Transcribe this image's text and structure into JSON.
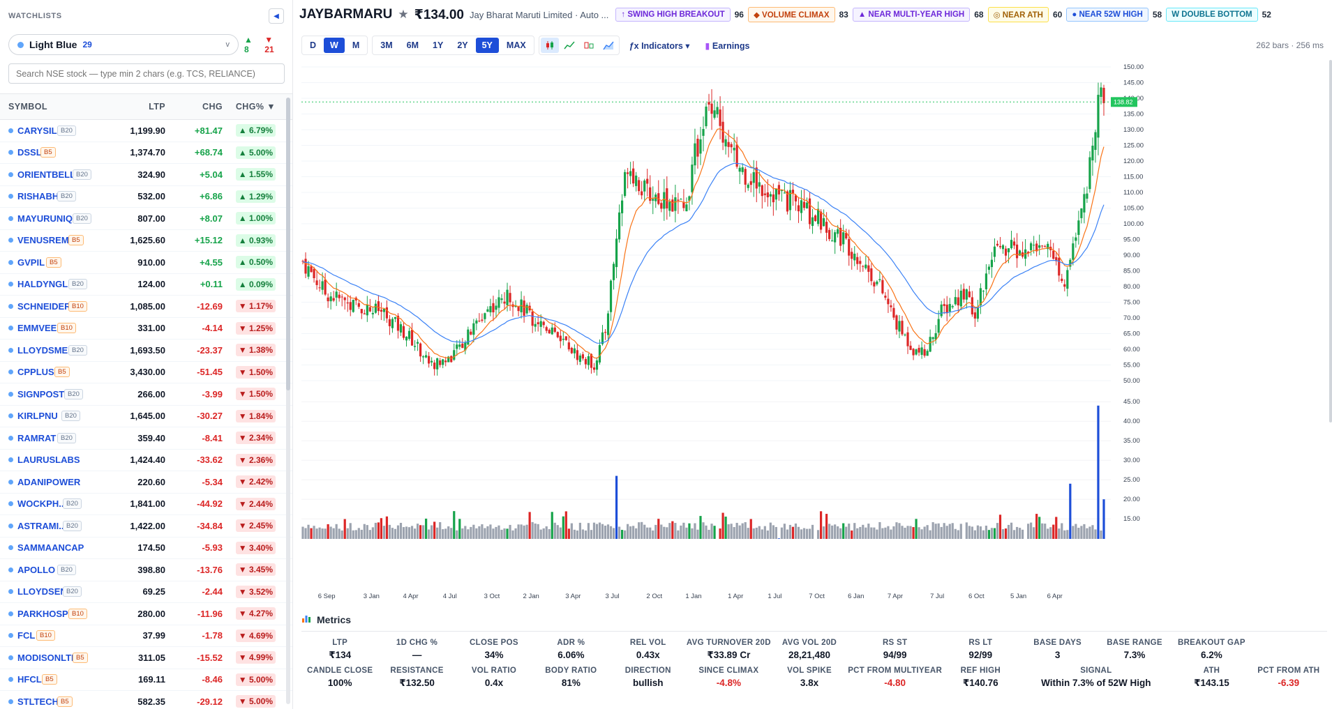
{
  "sidebar": {
    "title": "WATCHLISTS",
    "collapse_icon": "◀",
    "watchlist": {
      "name": "Light Blue",
      "count": "29",
      "advances": "▲ 8",
      "declines": "▼ 21"
    },
    "search_placeholder": "Search NSE stock — type min 2 chars (e.g. TCS, RELIANCE)",
    "columns": {
      "symbol": "SYMBOL",
      "ltp": "LTP",
      "chg": "CHG",
      "pct": "CHG% ▼"
    },
    "rows": [
      {
        "sym": "CARYSIL",
        "badge": "B20",
        "ltp": "1,199.90",
        "chg": "+81.47",
        "pct": "▲ 6.79%",
        "dir": "up"
      },
      {
        "sym": "DSSL",
        "badge": "B5",
        "ltp": "1,374.70",
        "chg": "+68.74",
        "pct": "▲ 5.00%",
        "dir": "up"
      },
      {
        "sym": "ORIENTBELL",
        "badge": "B20",
        "ltp": "324.90",
        "chg": "+5.04",
        "pct": "▲ 1.55%",
        "dir": "up"
      },
      {
        "sym": "RISHABH",
        "badge": "B20",
        "ltp": "532.00",
        "chg": "+6.86",
        "pct": "▲ 1.29%",
        "dir": "up"
      },
      {
        "sym": "MAYURUNIQ",
        "badge": "B20",
        "ltp": "807.00",
        "chg": "+8.07",
        "pct": "▲ 1.00%",
        "dir": "up"
      },
      {
        "sym": "VENUSREM",
        "badge": "B5",
        "ltp": "1,625.60",
        "chg": "+15.12",
        "pct": "▲ 0.93%",
        "dir": "up"
      },
      {
        "sym": "GVPIL",
        "badge": "B5",
        "ltp": "910.00",
        "chg": "+4.55",
        "pct": "▲ 0.50%",
        "dir": "up"
      },
      {
        "sym": "HALDYNGL",
        "badge": "B20",
        "ltp": "124.00",
        "chg": "+0.11",
        "pct": "▲ 0.09%",
        "dir": "up"
      },
      {
        "sym": "SCHNEIDER",
        "badge": "B10",
        "ltp": "1,085.00",
        "chg": "-12.69",
        "pct": "▼ 1.17%",
        "dir": "dn"
      },
      {
        "sym": "EMMVEE",
        "badge": "B10",
        "ltp": "331.00",
        "chg": "-4.14",
        "pct": "▼ 1.25%",
        "dir": "dn"
      },
      {
        "sym": "LLOYDSME",
        "badge": "B20",
        "ltp": "1,693.50",
        "chg": "-23.37",
        "pct": "▼ 1.38%",
        "dir": "dn"
      },
      {
        "sym": "CPPLUS",
        "badge": "B5",
        "ltp": "3,430.00",
        "chg": "-51.45",
        "pct": "▼ 1.50%",
        "dir": "dn"
      },
      {
        "sym": "SIGNPOST",
        "badge": "B20",
        "ltp": "266.00",
        "chg": "-3.99",
        "pct": "▼ 1.50%",
        "dir": "dn"
      },
      {
        "sym": "KIRLPNU",
        "badge": "B20",
        "ltp": "1,645.00",
        "chg": "-30.27",
        "pct": "▼ 1.84%",
        "dir": "dn"
      },
      {
        "sym": "RAMRAT",
        "badge": "B20",
        "ltp": "359.40",
        "chg": "-8.41",
        "pct": "▼ 2.34%",
        "dir": "dn"
      },
      {
        "sym": "LAURUSLABS",
        "badge": "",
        "ltp": "1,424.40",
        "chg": "-33.62",
        "pct": "▼ 2.36%",
        "dir": "dn"
      },
      {
        "sym": "ADANIPOWER",
        "badge": "",
        "ltp": "220.60",
        "chg": "-5.34",
        "pct": "▼ 2.42%",
        "dir": "dn"
      },
      {
        "sym": "WOCKPH...",
        "badge": "B20",
        "ltp": "1,841.00",
        "chg": "-44.92",
        "pct": "▼ 2.44%",
        "dir": "dn"
      },
      {
        "sym": "ASTRAMI...",
        "badge": "B20",
        "ltp": "1,422.00",
        "chg": "-34.84",
        "pct": "▼ 2.45%",
        "dir": "dn"
      },
      {
        "sym": "SAMMAANCAP",
        "badge": "",
        "ltp": "174.50",
        "chg": "-5.93",
        "pct": "▼ 3.40%",
        "dir": "dn"
      },
      {
        "sym": "APOLLO",
        "badge": "B20",
        "ltp": "398.80",
        "chg": "-13.76",
        "pct": "▼ 3.45%",
        "dir": "dn"
      },
      {
        "sym": "LLOYDSEN...",
        "badge": "B20",
        "ltp": "69.25",
        "chg": "-2.44",
        "pct": "▼ 3.52%",
        "dir": "dn"
      },
      {
        "sym": "PARKHOSPS",
        "badge": "B10",
        "ltp": "280.00",
        "chg": "-11.96",
        "pct": "▼ 4.27%",
        "dir": "dn"
      },
      {
        "sym": "FCL",
        "badge": "B10",
        "ltp": "37.99",
        "chg": "-1.78",
        "pct": "▼ 4.69%",
        "dir": "dn"
      },
      {
        "sym": "MODISONLTD",
        "badge": "B5",
        "ltp": "311.05",
        "chg": "-15.52",
        "pct": "▼ 4.99%",
        "dir": "dn"
      },
      {
        "sym": "HFCL",
        "badge": "B5",
        "ltp": "169.11",
        "chg": "-8.46",
        "pct": "▼ 5.00%",
        "dir": "dn"
      },
      {
        "sym": "STLTECH",
        "badge": "B5",
        "ltp": "582.35",
        "chg": "-29.12",
        "pct": "▼ 5.00%",
        "dir": "dn"
      }
    ]
  },
  "header": {
    "ticker": "JAYBARMARU",
    "star": "★",
    "price": "₹134.00",
    "company": "Jay Bharat Maruti Limited · Auto ...",
    "signals": [
      {
        "label": "↑ SWING HIGH BREAKOUT",
        "score": "96"
      },
      {
        "label": "◆ VOLUME CLIMAX",
        "score": "83"
      },
      {
        "label": "▲ NEAR MULTI-YEAR HIGH",
        "score": "68"
      },
      {
        "label": "◎ NEAR ATH",
        "score": "60"
      },
      {
        "label": "● NEAR 52W HIGH",
        "score": "58"
      },
      {
        "label": "W DOUBLE BOTTOM",
        "score": "52"
      }
    ]
  },
  "toolbar": {
    "intervals": [
      "D",
      "W",
      "M"
    ],
    "active_interval": "W",
    "ranges": [
      "3M",
      "6M",
      "1Y",
      "2Y",
      "5Y",
      "MAX"
    ],
    "active_range": "5Y",
    "chart_types": [
      "candlestick-icon",
      "line-chart-icon",
      "heikin-ashi-icon",
      "area-chart-icon"
    ],
    "indicators": "ƒx Indicators ▾",
    "earnings": "Earnings",
    "bars_info": "262 bars · 256 ms"
  },
  "chart_data": {
    "type": "candlestick",
    "ylim": [
      50,
      150
    ],
    "y_ticks": [
      "150.00",
      "145.00",
      "140.00",
      "135.00",
      "130.00",
      "125.00",
      "120.00",
      "115.00",
      "110.00",
      "105.00",
      "100.00",
      "95.00",
      "90.00",
      "85.00",
      "80.00",
      "75.00",
      "70.00",
      "65.00",
      "60.00",
      "55.00",
      "50.00"
    ],
    "volume_ticks": [
      "45.00",
      "40.00",
      "35.00",
      "30.00",
      "25.00",
      "20.00",
      "15.00"
    ],
    "x_ticks": [
      "6 Sep",
      "3 Jan",
      "4 Apr",
      "4 Jul",
      "3 Oct",
      "2 Jan",
      "3 Apr",
      "3 Jul",
      "2 Oct",
      "1 Jan",
      "1 Apr",
      "1 Jul",
      "7 Oct",
      "6 Jan",
      "7 Apr",
      "7 Jul",
      "6 Oct",
      "5 Jan",
      "6 Apr"
    ],
    "last_price_label": "138.82",
    "trend_keypoints": [
      [
        0,
        88
      ],
      [
        8,
        78
      ],
      [
        18,
        74
      ],
      [
        28,
        72
      ],
      [
        38,
        64
      ],
      [
        46,
        55
      ],
      [
        52,
        57
      ],
      [
        58,
        63
      ],
      [
        66,
        73
      ],
      [
        74,
        77
      ],
      [
        82,
        70
      ],
      [
        90,
        66
      ],
      [
        98,
        58
      ],
      [
        104,
        55
      ],
      [
        108,
        66
      ],
      [
        112,
        95
      ],
      [
        116,
        120
      ],
      [
        122,
        110
      ],
      [
        130,
        108
      ],
      [
        136,
        104
      ],
      [
        142,
        130
      ],
      [
        146,
        140
      ],
      [
        150,
        126
      ],
      [
        156,
        118
      ],
      [
        164,
        112
      ],
      [
        172,
        108
      ],
      [
        180,
        104
      ],
      [
        186,
        100
      ],
      [
        192,
        96
      ],
      [
        198,
        90
      ],
      [
        206,
        80
      ],
      [
        212,
        68
      ],
      [
        218,
        60
      ],
      [
        222,
        58
      ],
      [
        228,
        72
      ],
      [
        236,
        78
      ],
      [
        240,
        72
      ],
      [
        246,
        90
      ],
      [
        252,
        92
      ],
      [
        258,
        90
      ],
      [
        264,
        95
      ],
      [
        268,
        90
      ],
      [
        272,
        82
      ],
      [
        276,
        95
      ],
      [
        280,
        110
      ],
      [
        282,
        128
      ],
      [
        284,
        140
      ],
      [
        286,
        138
      ]
    ],
    "volume_spikes": [
      [
        112,
        26
      ],
      [
        148,
        9
      ],
      [
        170,
        10
      ],
      [
        183,
        9
      ],
      [
        236,
        9
      ],
      [
        258,
        9
      ],
      [
        274,
        24
      ],
      [
        284,
        44
      ],
      [
        286,
        20
      ]
    ],
    "colors": {
      "up": "#16a34a",
      "down": "#dc2626",
      "ema_fast": "#f97316",
      "ema_slow": "#3b82f6",
      "vol_up": "#16a34a",
      "vol_down": "#dc2626",
      "vol_neutral": "#9ca3af",
      "vol_spike": "#1d4ed8"
    }
  },
  "metrics": {
    "title": "Metrics",
    "items": [
      {
        "label": "LTP",
        "value": "₹134"
      },
      {
        "label": "1D CHG %",
        "value": "—"
      },
      {
        "label": "CLOSE POS",
        "value": "34%"
      },
      {
        "label": "ADR %",
        "value": "6.06%"
      },
      {
        "label": "REL VOL",
        "value": "0.43x"
      },
      {
        "label": "AVG TURNOVER 20D",
        "value": "₹33.89 Cr"
      },
      {
        "label": "AVG VOL 20D",
        "value": "28,21,480"
      },
      {
        "label": "RS ST",
        "value": "94/99"
      },
      {
        "label": "RS LT",
        "value": "92/99"
      },
      {
        "label": "BASE DAYS",
        "value": "3"
      },
      {
        "label": "BASE RANGE",
        "value": "7.3%"
      },
      {
        "label": "BREAKOUT GAP",
        "value": "6.2%"
      },
      {
        "label": "",
        "value": ""
      },
      {
        "label": "CANDLE CLOSE",
        "value": "100%"
      },
      {
        "label": "RESISTANCE",
        "value": "₹132.50"
      },
      {
        "label": "VOL RATIO",
        "value": "0.4x"
      },
      {
        "label": "BODY RATIO",
        "value": "81%"
      },
      {
        "label": "DIRECTION",
        "value": "bullish"
      },
      {
        "label": "SINCE CLIMAX",
        "value": "-4.8%",
        "neg": true
      },
      {
        "label": "VOL SPIKE",
        "value": "3.8x"
      },
      {
        "label": "PCT FROM MULTIYEAR",
        "value": "-4.80",
        "neg": true
      },
      {
        "label": "REF HIGH",
        "value": "₹140.76"
      },
      {
        "label": "SIGNAL",
        "value": "Within 7.3% of 52W High",
        "wide": true
      },
      {
        "label": "ATH",
        "value": "₹143.15"
      },
      {
        "label": "PCT FROM ATH",
        "value": "-6.39",
        "neg": true
      }
    ]
  }
}
